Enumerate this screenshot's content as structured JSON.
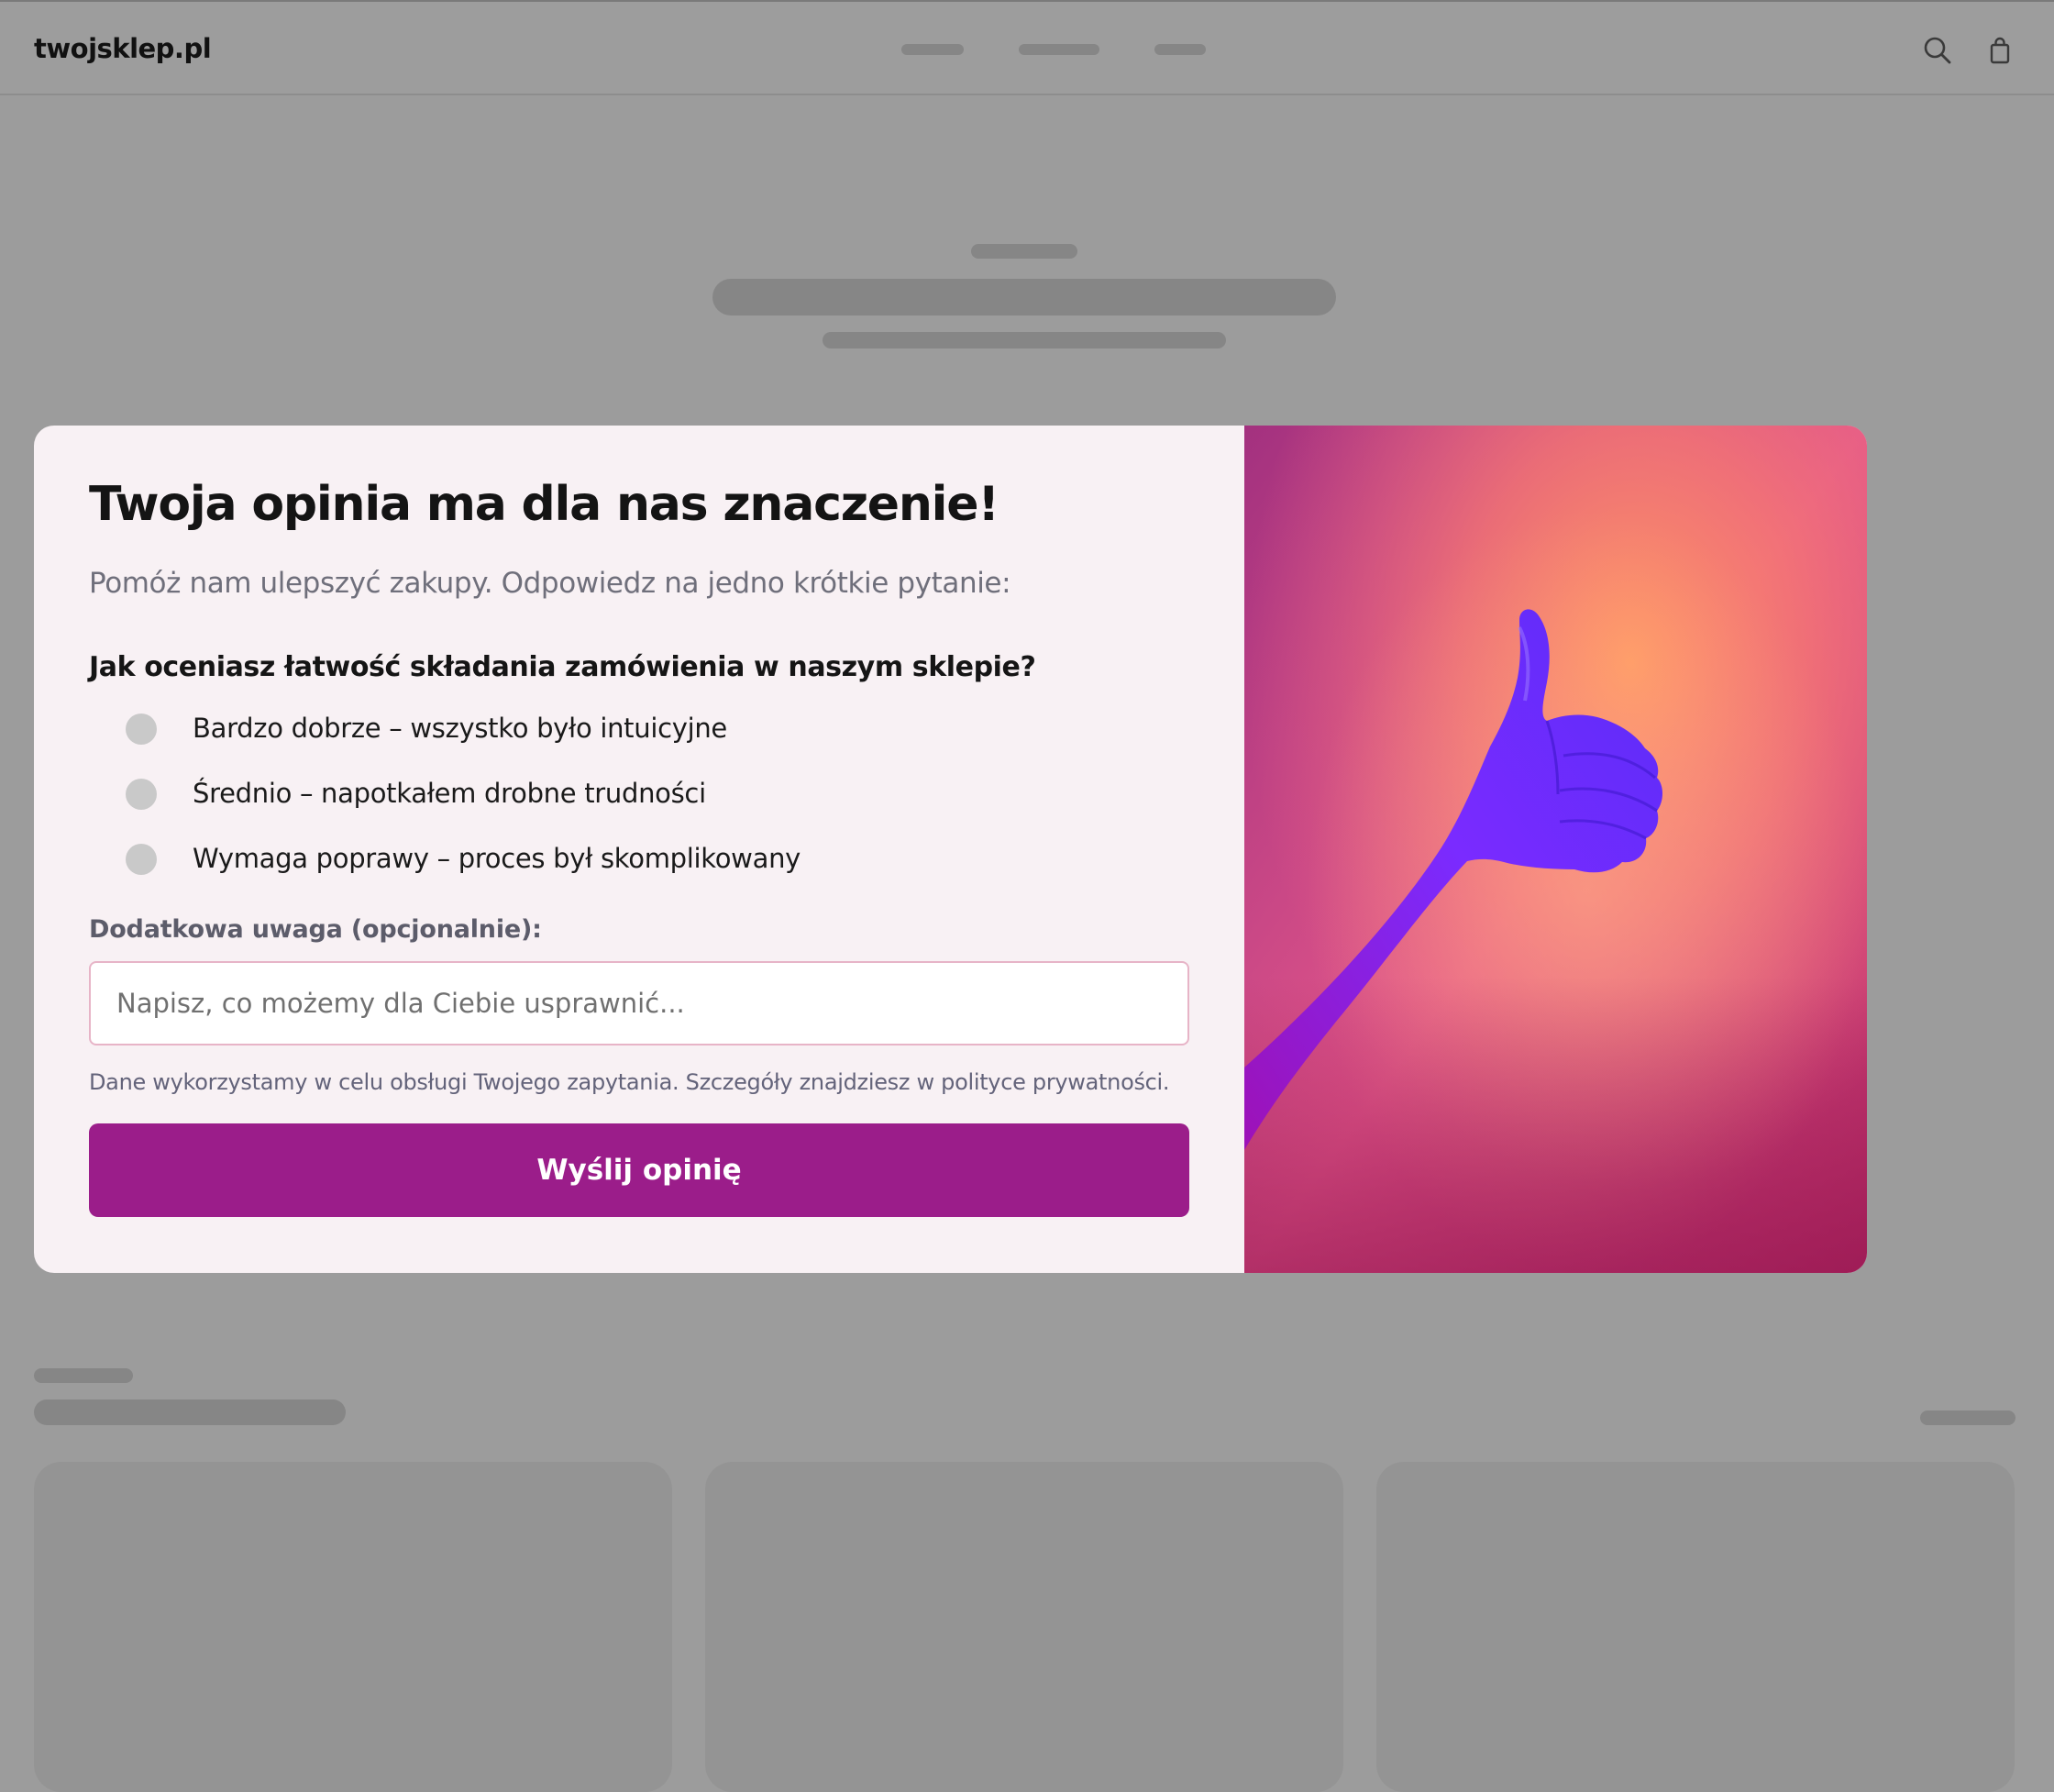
{
  "header": {
    "site_name": "twojsklep.pl",
    "icons": [
      "search-icon",
      "shopping-bag-icon"
    ]
  },
  "modal": {
    "title": "Twoja opinia ma dla nas znaczenie!",
    "subtitle": "Pomóż nam ulepszyć zakupy. Odpowiedz na jedno krótkie pytanie:",
    "question": "Jak oceniasz łatwość składania zamówienia w naszym sklepie?",
    "options": [
      {
        "label": "Bardzo dobrze – wszystko było intuicyjne",
        "selected": false
      },
      {
        "label": "Średnio – napotkałem drobne trudności",
        "selected": false
      },
      {
        "label": "Wymaga poprawy – proces był skomplikowany",
        "selected": false
      }
    ],
    "comment_label": "Dodatkowa uwaga (opcjonalnie):",
    "comment_placeholder": "Napisz, co możemy dla Ciebie usprawnić...",
    "comment_value": "",
    "privacy_note": "Dane wykorzystamy w celu obsługi Twojego zapytania. Szczegóły znajdziesz w polityce prywatności.",
    "submit_label": "Wyślij opinię",
    "image_icon": "thumbs-up-icon"
  },
  "colors": {
    "accent": "#9b1d8a",
    "modal_background": "#f8f1f4",
    "overlay": "#9c9c9c",
    "input_border": "#e7b4c7"
  }
}
